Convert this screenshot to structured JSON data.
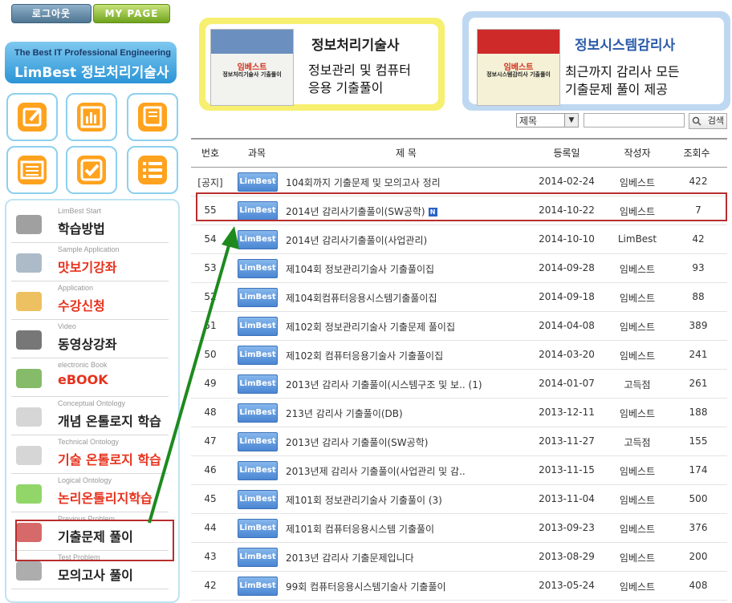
{
  "sidebar": {
    "logout_label": "로그아웃",
    "mypage_label": "MY PAGE",
    "banner_sub": "The Best IT Professional Engineering",
    "banner_main": "LimBest 정보처리기술사",
    "menu": [
      {
        "en": "LimBest Start",
        "ko": "학습방법",
        "red": false
      },
      {
        "en": "Sample Application",
        "ko": "맛보기강좌",
        "red": true
      },
      {
        "en": "Application",
        "ko": "수강신청",
        "red": true
      },
      {
        "en": "Video",
        "ko": "동영상강좌",
        "red": false
      },
      {
        "en": "electronic Book",
        "ko": "eBOOK",
        "red": true
      },
      {
        "en": "Conceptual Ontology",
        "ko": "개념 온톨로지 학습",
        "red": false
      },
      {
        "en": "Technical Ontology",
        "ko": "기술 온톨로지 학습",
        "red": true
      },
      {
        "en": "Logical Ontology",
        "ko": "논리온톨리지학습",
        "red": true
      },
      {
        "en": "Previous Problem",
        "ko": "기출문제 풀이",
        "red": false
      },
      {
        "en": "Test Problem",
        "ko": "모의고사 풀이",
        "red": false
      }
    ]
  },
  "books": {
    "book1": {
      "brand": "임베스트",
      "cover_title": "정보처리기술사 기출풀이",
      "title": "정보처리기술사",
      "desc1": "정보관리 및 컴퓨터",
      "desc2": "응용 기출풀이"
    },
    "book2": {
      "brand": "임베스트",
      "cover_title": "정보시스템감리사 기출풀이",
      "title": "정보시스템감리사",
      "desc1": "최근까지 감리사 모든",
      "desc2": "기출문제 풀이 제공"
    }
  },
  "search": {
    "selected": "제목",
    "button": "검색"
  },
  "table": {
    "headers": {
      "no": "번호",
      "subject": "과목",
      "title": "제 목",
      "date": "등록일",
      "author": "작성자",
      "views": "조회수"
    },
    "badge": "LimBest",
    "rows": [
      {
        "no": "[공지]",
        "title": "104회까지 기출문제 및 모의고사 정리",
        "date": "2014-02-24",
        "author": "임베스트",
        "views": "422",
        "new": false
      },
      {
        "no": "55",
        "title": "2014년 감리사기출풀이(SW공학)",
        "date": "2014-10-22",
        "author": "임베스트",
        "views": "7",
        "new": true
      },
      {
        "no": "54",
        "title": "2014년 감리사기출풀이(사업관리)",
        "date": "2014-10-10",
        "author": "LimBest",
        "views": "42",
        "new": false
      },
      {
        "no": "53",
        "title": "제104회 정보관리기술사 기출풀이집",
        "date": "2014-09-28",
        "author": "임베스트",
        "views": "93",
        "new": false
      },
      {
        "no": "52",
        "title": "제104회컴퓨터응용시스템기출풀이집",
        "date": "2014-09-18",
        "author": "임베스트",
        "views": "88",
        "new": false
      },
      {
        "no": "51",
        "title": "제102회 정보관리기술사 기출문제 풀이집",
        "date": "2014-04-08",
        "author": "임베스트",
        "views": "389",
        "new": false
      },
      {
        "no": "50",
        "title": "제102회 컴퓨터응용기술사 기출풀이집",
        "date": "2014-03-20",
        "author": "임베스트",
        "views": "241",
        "new": false
      },
      {
        "no": "49",
        "title": "2013년 감리사 기출풀이(시스템구조 및 보.. (1)",
        "date": "2014-01-07",
        "author": "고득점",
        "views": "261",
        "new": false
      },
      {
        "no": "48",
        "title": "213년 감리사 기출풀이(DB)",
        "date": "2013-12-11",
        "author": "임베스트",
        "views": "188",
        "new": false
      },
      {
        "no": "47",
        "title": "2013년 감리사 기출풀이(SW공학)",
        "date": "2013-11-27",
        "author": "고득점",
        "views": "155",
        "new": false
      },
      {
        "no": "46",
        "title": "2013년제 감리사 기출풀이(사업관리 및 감..",
        "date": "2013-11-15",
        "author": "임베스트",
        "views": "174",
        "new": false
      },
      {
        "no": "45",
        "title": "제101회 정보관리기술사 기출풀이 (3)",
        "date": "2013-11-04",
        "author": "임베스트",
        "views": "500",
        "new": false
      },
      {
        "no": "44",
        "title": "제101회 컴퓨터응용시스템 기출풀이",
        "date": "2013-09-23",
        "author": "임베스트",
        "views": "376",
        "new": false
      },
      {
        "no": "43",
        "title": "2013년 감리사 기출문제입니다",
        "date": "2013-08-29",
        "author": "임베스트",
        "views": "200",
        "new": false
      },
      {
        "no": "42",
        "title": "99회 컴퓨터응용시스템기술사 기출풀이",
        "date": "2013-05-24",
        "author": "임베스트",
        "views": "408",
        "new": false
      }
    ]
  },
  "colors": {
    "accent_red": "#b82d2d",
    "arrow_green": "#1e8a1e",
    "badge_blue": "#4a86d3"
  }
}
